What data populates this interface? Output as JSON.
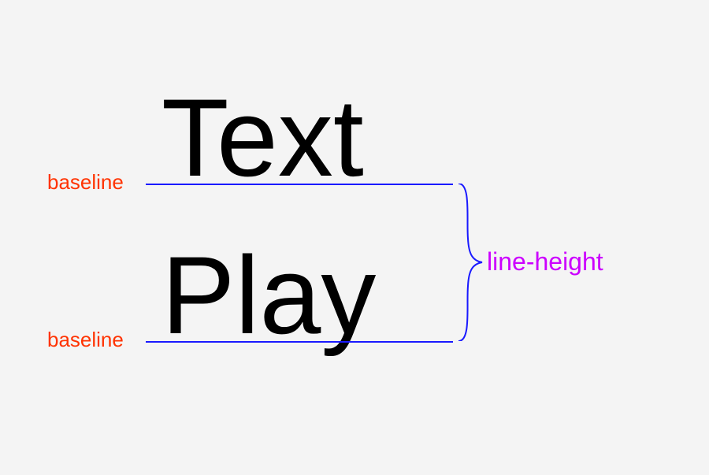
{
  "diagram": {
    "word1": "Text",
    "word2": "Play",
    "baseline_label_1": "baseline",
    "baseline_label_2": "baseline",
    "line_height_label": "line-height",
    "colors": {
      "baseline_label": "#ff3300",
      "baseline_line": "#1a1aff",
      "line_height_label": "#cc00ff",
      "brace": "#1a1aff",
      "background": "#f4f4f4"
    }
  }
}
